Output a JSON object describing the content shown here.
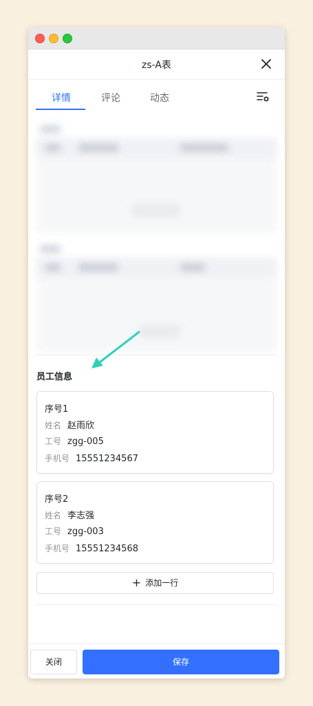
{
  "window": {
    "title": "zs-A表"
  },
  "tabs": [
    {
      "label": "详情",
      "active": true
    },
    {
      "label": "评论",
      "active": false
    },
    {
      "label": "动态",
      "active": false
    }
  ],
  "icons": {
    "close": "close-icon",
    "settings": "list-settings-icon",
    "plus": "plus-icon"
  },
  "section": {
    "title": "员工信息"
  },
  "employees": [
    {
      "seq": "序号1",
      "name_label": "姓名",
      "name": "赵雨欣",
      "id_label": "工号",
      "id": "zgg-005",
      "phone_label": "手机号",
      "phone": "15551234567"
    },
    {
      "seq": "序号2",
      "name_label": "姓名",
      "name": "李志强",
      "id_label": "工号",
      "id": "zgg-003",
      "phone_label": "手机号",
      "phone": "15551234568"
    }
  ],
  "add_row": {
    "label": "添加一行"
  },
  "footer": {
    "close_label": "关闭",
    "save_label": "保存"
  },
  "colors": {
    "accent": "#3370ff",
    "arrow": "#2fd1b8",
    "background": "#faf0e0"
  }
}
